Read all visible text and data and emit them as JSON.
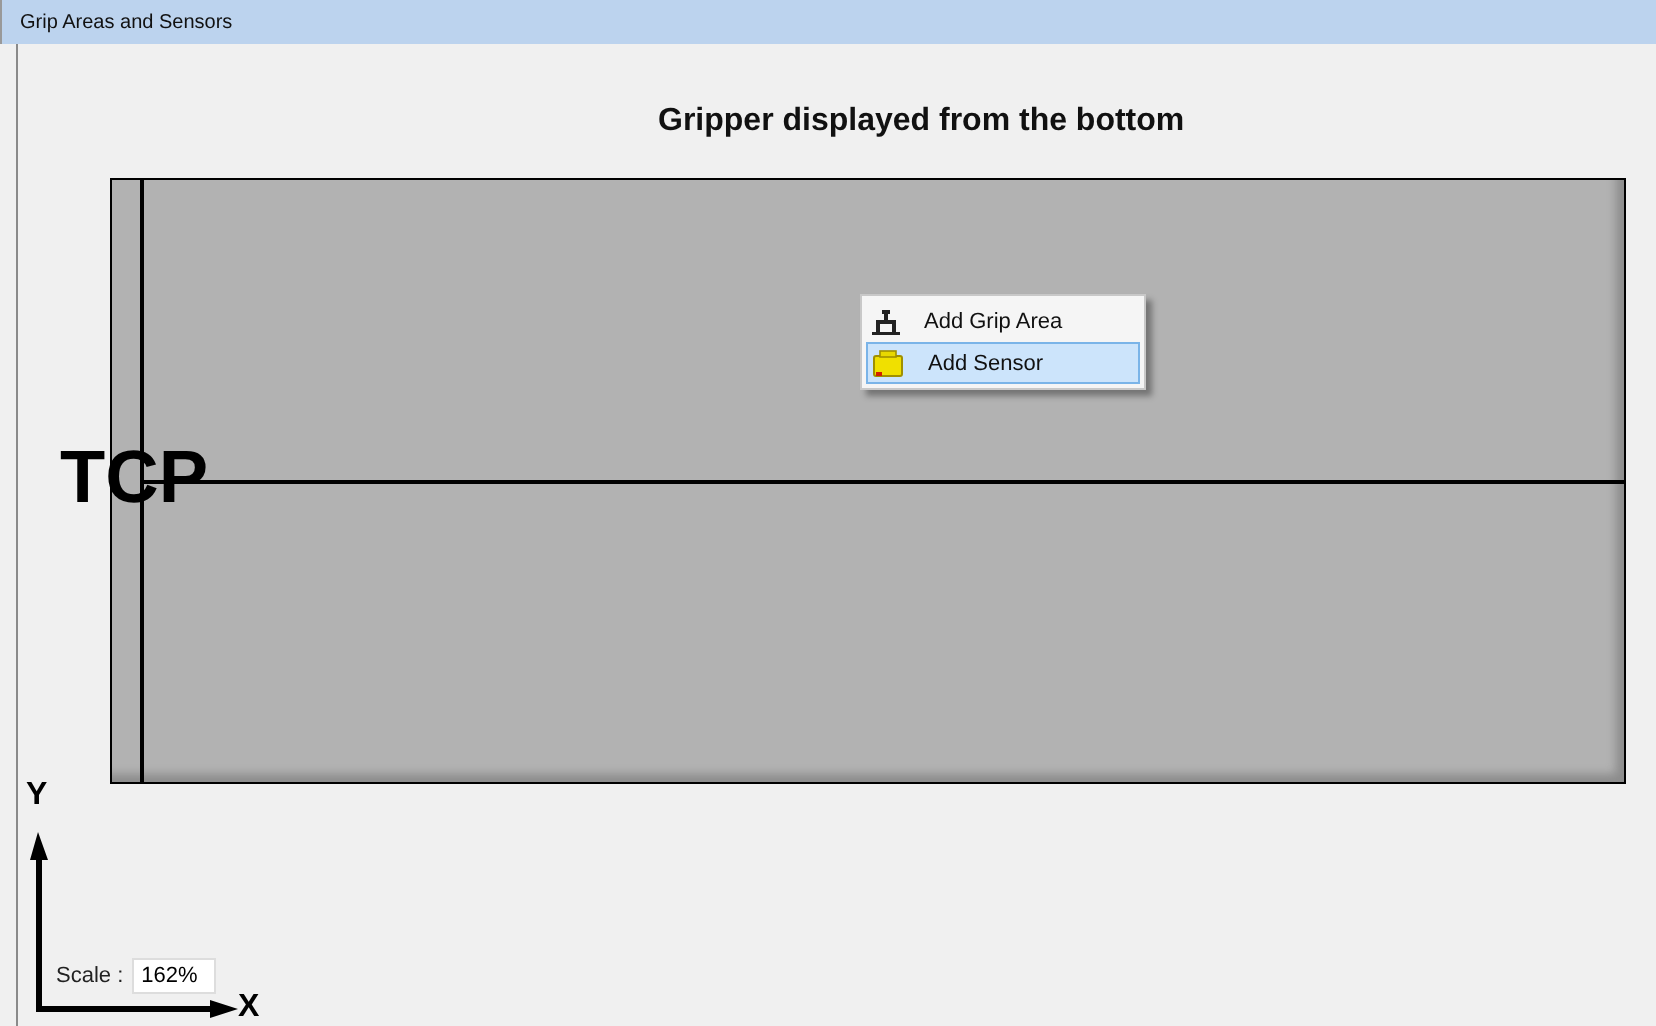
{
  "window": {
    "title": "Grip Areas and Sensors"
  },
  "canvas": {
    "heading": "Gripper displayed from the bottom",
    "tcp_label": "TCP",
    "y_axis_label": "Y",
    "x_axis_label": "X"
  },
  "context_menu": {
    "items": [
      {
        "label": "Add Grip Area",
        "kind": "grip",
        "selected": false
      },
      {
        "label": "Add Sensor",
        "kind": "sensor",
        "selected": true
      }
    ]
  },
  "scale": {
    "label": "Scale :",
    "value": "162%"
  }
}
